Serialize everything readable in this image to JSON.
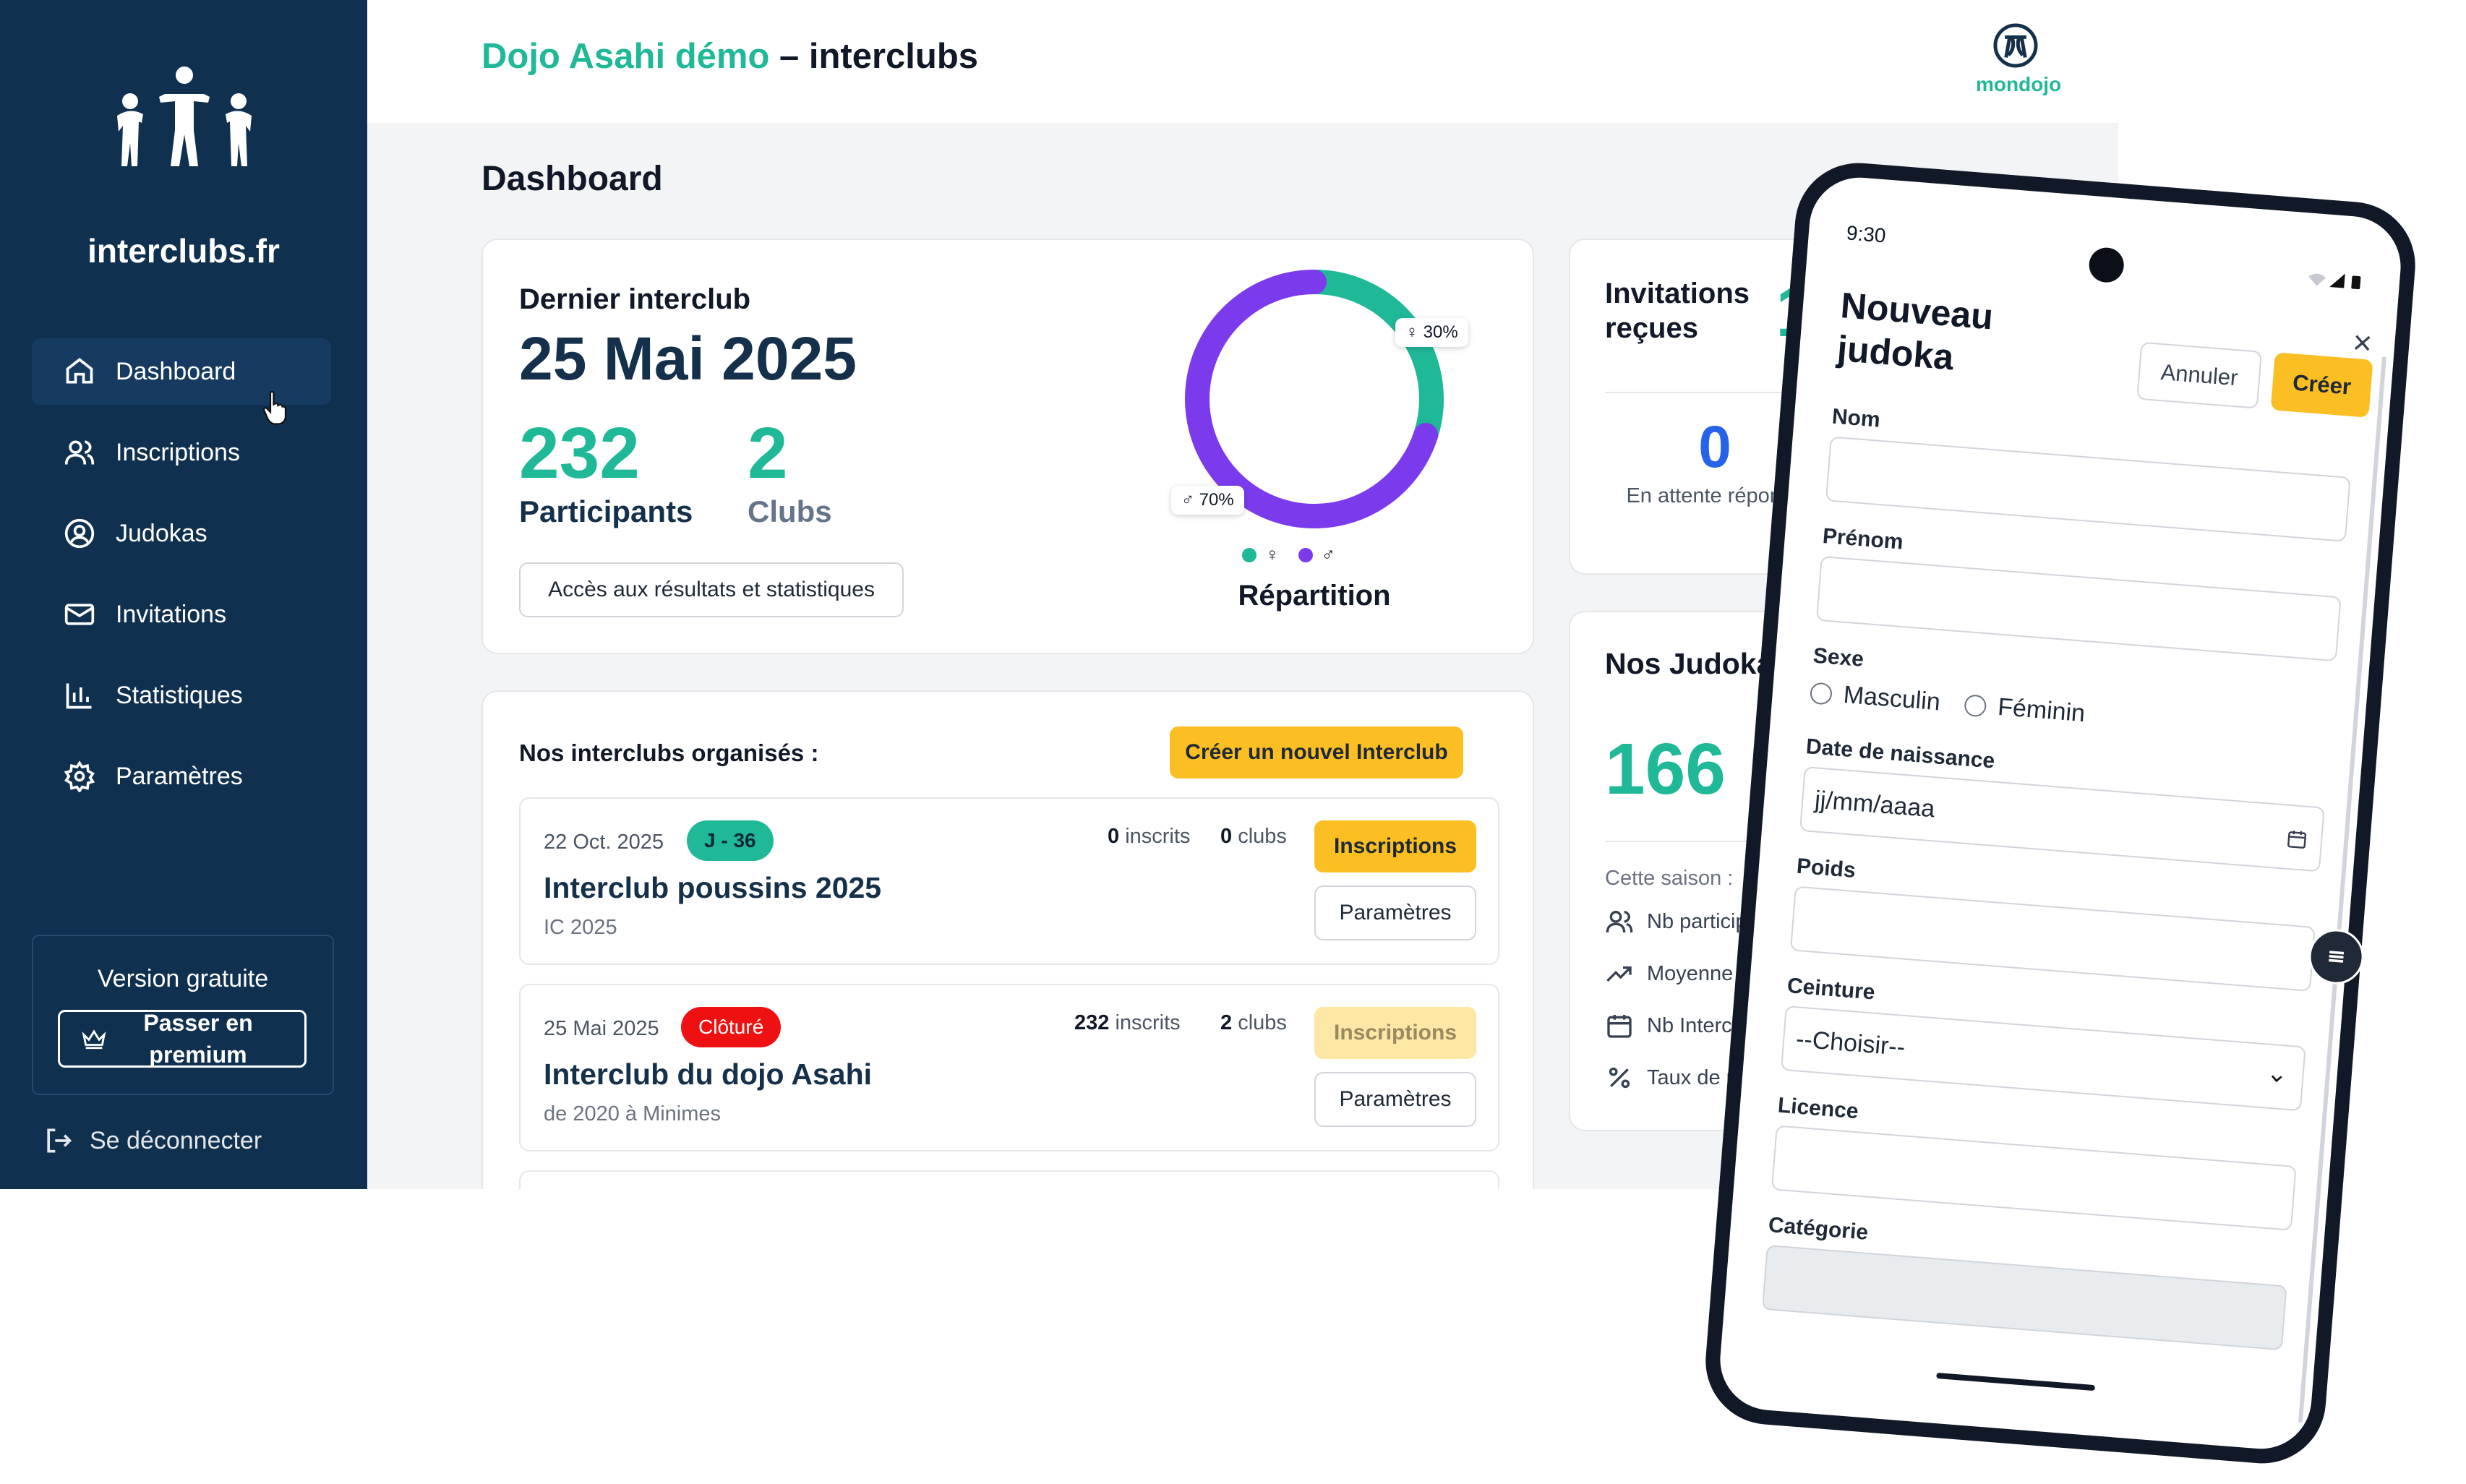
{
  "sidebar": {
    "brand": "interclubs.fr",
    "items": [
      {
        "label": "Dashboard",
        "icon": "home-icon"
      },
      {
        "label": "Inscriptions",
        "icon": "users-icon"
      },
      {
        "label": "Judokas",
        "icon": "user-circle-icon"
      },
      {
        "label": "Invitations",
        "icon": "mail-icon"
      },
      {
        "label": "Statistiques",
        "icon": "bar-chart-icon"
      },
      {
        "label": "Paramètres",
        "icon": "gear-icon"
      }
    ],
    "version_label": "Version gratuite",
    "premium_label": "Passer en premium",
    "logout_label": "Se déconnecter"
  },
  "header": {
    "title_club": "Dojo Asahi démo",
    "title_separator": " – ",
    "title_app": "interclubs",
    "partner": "mondojo"
  },
  "page": {
    "title": "Dashboard"
  },
  "last_interclub": {
    "label": "Dernier interclub",
    "date": "25 Mai 2025",
    "participants_value": "232",
    "participants_label": "Participants",
    "clubs_value": "2",
    "clubs_label": "Clubs",
    "results_button": "Accès aux résultats et statistiques",
    "chart_title": "Répartition"
  },
  "chart_data": {
    "type": "pie",
    "title": "Répartition",
    "categories": [
      "♀",
      "♂"
    ],
    "values": [
      30,
      70
    ],
    "labels": [
      "♀ 30%",
      "♂ 70%"
    ],
    "colors": [
      "#1fb997",
      "#7c3aed"
    ],
    "legend_position": "bottom"
  },
  "invitations": {
    "title": "Invitations reçues",
    "count": "1",
    "pending_value": "0",
    "pending_label": "En attente réponse"
  },
  "judokas": {
    "title": "Nos Judokas",
    "count": "166",
    "season_label": "Cette saison :",
    "rows": [
      {
        "icon": "users-icon",
        "label": "Nb participat"
      },
      {
        "icon": "trend-up-icon",
        "label": "Moyenne pa"
      },
      {
        "icon": "calendar-icon",
        "label": "Nb Interclub"
      },
      {
        "icon": "percent-icon",
        "label": "Taux de par"
      }
    ]
  },
  "interclubs_list": {
    "title": "Nos interclubs organisés :",
    "create_button": "Créer un nouvel Interclub",
    "items": [
      {
        "date": "22 Oct. 2025",
        "badge": "J - 36",
        "name": "Interclub poussins 2025",
        "subtitle": "IC 2025",
        "inscrits_value": "0",
        "inscrits_label": " inscrits",
        "clubs_value": "0",
        "clubs_label": " clubs",
        "inscriptions_button": "Inscriptions",
        "settings_button": "Paramètres"
      },
      {
        "date": "25 Mai 2025",
        "badge": "Clôturé",
        "name": "Interclub du dojo Asahi",
        "subtitle": "de 2020 à Minimes",
        "inscrits_value": "232",
        "inscrits_label": " inscrits",
        "clubs_value": "2",
        "clubs_label": " clubs",
        "inscriptions_button": "Inscriptions",
        "settings_button": "Paramètres"
      }
    ]
  },
  "phone": {
    "time": "9:30",
    "title": "Nouveau judoka",
    "cancel_button": "Annuler",
    "create_button": "Créer",
    "close_symbol": "×",
    "fields": {
      "nom_label": "Nom",
      "prenom_label": "Prénom",
      "sexe_label": "Sexe",
      "sexe_options": [
        "Masculin",
        "Féminin"
      ],
      "date_label": "Date de naissance",
      "date_placeholder": "jj/mm/aaaa",
      "poids_label": "Poids",
      "ceinture_label": "Ceinture",
      "ceinture_selected": "--Choisir--",
      "licence_label": "Licence",
      "categorie_label": "Catégorie"
    }
  }
}
